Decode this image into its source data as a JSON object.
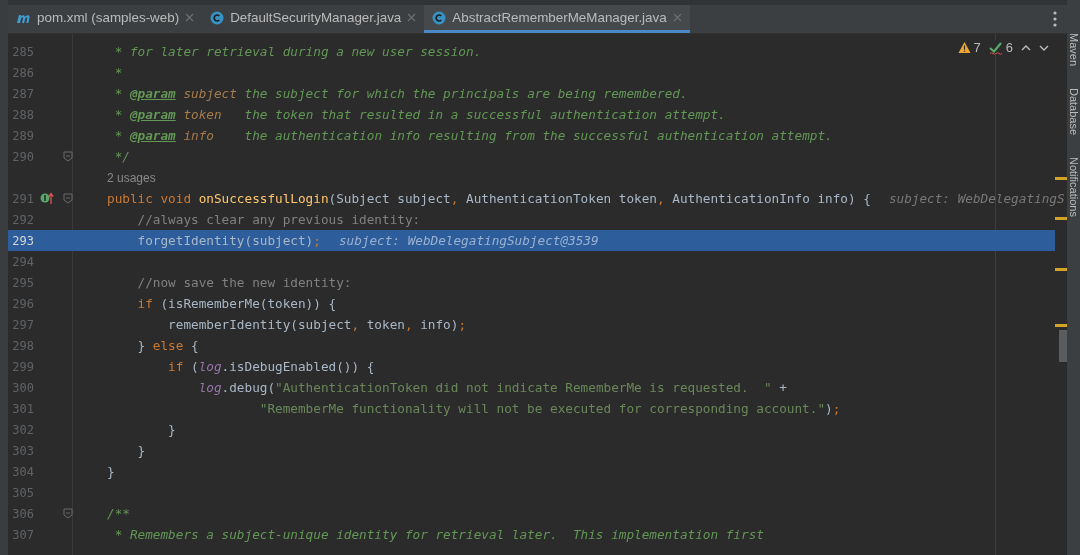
{
  "tabs": [
    {
      "label": "pom.xml (samples-web)",
      "selected": false
    },
    {
      "label": "DefaultSecurityManager.java",
      "selected": false
    },
    {
      "label": "AbstractRememberMeManager.java",
      "selected": true
    }
  ],
  "inspections": {
    "warnings": "7",
    "weak_warnings": "6"
  },
  "lines": [
    {
      "kind": "code",
      "number": "285",
      "current": false,
      "fold": false,
      "gutter_marker": false,
      "segments": [
        {
          "kind": "doc",
          "text": " * for later retrieval during a new user session."
        }
      ]
    },
    {
      "kind": "code",
      "number": "286",
      "current": false,
      "fold": false,
      "gutter_marker": false,
      "segments": [
        {
          "kind": "doc",
          "text": " *"
        }
      ]
    },
    {
      "kind": "code",
      "number": "287",
      "current": false,
      "fold": false,
      "gutter_marker": false,
      "segments": [
        {
          "kind": "doc",
          "text": " * "
        },
        {
          "kind": "doctag",
          "text": "@param"
        },
        {
          "kind": "docparam",
          "text": " subject"
        },
        {
          "kind": "doc",
          "text": " the subject for which the principals are being remembered."
        }
      ]
    },
    {
      "kind": "code",
      "number": "288",
      "current": false,
      "fold": false,
      "gutter_marker": false,
      "segments": [
        {
          "kind": "doc",
          "text": " * "
        },
        {
          "kind": "doctag",
          "text": "@param"
        },
        {
          "kind": "docparam",
          "text": " token"
        },
        {
          "kind": "doc",
          "text": "   the token that resulted in a successful authentication attempt."
        }
      ]
    },
    {
      "kind": "code",
      "number": "289",
      "current": false,
      "fold": false,
      "gutter_marker": false,
      "segments": [
        {
          "kind": "doc",
          "text": " * "
        },
        {
          "kind": "doctag",
          "text": "@param"
        },
        {
          "kind": "docparam",
          "text": " info"
        },
        {
          "kind": "doc",
          "text": "    the authentication info resulting from the successful authentication attempt."
        }
      ]
    },
    {
      "kind": "code",
      "number": "290",
      "current": false,
      "fold": true,
      "gutter_marker": false,
      "segments": [
        {
          "kind": "doc",
          "text": " */"
        }
      ]
    },
    {
      "kind": "inlay",
      "text": "2 usages"
    },
    {
      "kind": "code",
      "number": "291",
      "current": false,
      "fold": true,
      "gutter_marker": true,
      "segments": [
        {
          "kind": "keyword",
          "text": "public void "
        },
        {
          "kind": "function",
          "text": "onSuccessfulLogin"
        },
        {
          "kind": "plain",
          "text": "(Subject subject"
        },
        {
          "kind": "keyword",
          "text": ", "
        },
        {
          "kind": "plain",
          "text": "AuthenticationToken token"
        },
        {
          "kind": "keyword",
          "text": ", "
        },
        {
          "kind": "plain",
          "text": "AuthenticationInfo info) {"
        },
        {
          "kind": "hint",
          "text": "subject: WebDelegatingS"
        }
      ]
    },
    {
      "kind": "code",
      "number": "292",
      "current": false,
      "fold": false,
      "gutter_marker": false,
      "segments": [
        {
          "kind": "comment",
          "text": "    //always clear any previous identity:"
        }
      ]
    },
    {
      "kind": "code",
      "number": "293",
      "current": true,
      "fold": false,
      "gutter_marker": false,
      "segments": [
        {
          "kind": "plain",
          "text": "    forgetIdentity(subject)"
        },
        {
          "kind": "keyword",
          "text": ";"
        },
        {
          "kind": "hint",
          "text": "subject: WebDelegatingSubject@3539"
        }
      ]
    },
    {
      "kind": "code",
      "number": "294",
      "current": false,
      "fold": false,
      "gutter_marker": false
    },
    {
      "kind": "code",
      "number": "295",
      "current": false,
      "fold": false,
      "gutter_marker": false,
      "segments": [
        {
          "kind": "comment",
          "text": "    //now save the new identity:"
        }
      ]
    },
    {
      "kind": "code",
      "number": "296",
      "current": false,
      "fold": false,
      "gutter_marker": false,
      "segments": [
        {
          "kind": "keyword",
          "text": "    if"
        },
        {
          "kind": "plain",
          "text": " (isRememberMe(token)) {"
        }
      ]
    },
    {
      "kind": "code",
      "number": "297",
      "current": false,
      "fold": false,
      "gutter_marker": false,
      "segments": [
        {
          "kind": "plain",
          "text": "        rememberIdentity(subject"
        },
        {
          "kind": "keyword",
          "text": ", "
        },
        {
          "kind": "plain",
          "text": "token"
        },
        {
          "kind": "keyword",
          "text": ", "
        },
        {
          "kind": "plain",
          "text": "info)"
        },
        {
          "kind": "keyword",
          "text": ";"
        }
      ]
    },
    {
      "kind": "code",
      "number": "298",
      "current": false,
      "fold": false,
      "gutter_marker": false,
      "segments": [
        {
          "kind": "plain",
          "text": "    } "
        },
        {
          "kind": "keyword",
          "text": "else"
        },
        {
          "kind": "plain",
          "text": " {"
        }
      ]
    },
    {
      "kind": "code",
      "number": "299",
      "current": false,
      "fold": false,
      "gutter_marker": false,
      "segments": [
        {
          "kind": "keyword",
          "text": "        if"
        },
        {
          "kind": "plain",
          "text": " ("
        },
        {
          "kind": "field",
          "text": "log"
        },
        {
          "kind": "plain",
          "text": ".isDebugEnabled()) {"
        }
      ]
    },
    {
      "kind": "code",
      "number": "300",
      "current": false,
      "fold": false,
      "gutter_marker": false,
      "segments": [
        {
          "kind": "field",
          "text": "            log"
        },
        {
          "kind": "plain",
          "text": ".debug("
        },
        {
          "kind": "string",
          "text": "\"AuthenticationToken did not indicate RememberMe is requested.  \""
        },
        {
          "kind": "plain",
          "text": " +"
        }
      ]
    },
    {
      "kind": "code",
      "number": "301",
      "current": false,
      "fold": false,
      "gutter_marker": false,
      "segments": [
        {
          "kind": "string",
          "text": "                    \"RememberMe functionality will not be executed for corresponding account.\""
        },
        {
          "kind": "plain",
          "text": ")"
        },
        {
          "kind": "keyword",
          "text": ";"
        }
      ]
    },
    {
      "kind": "code",
      "number": "302",
      "current": false,
      "fold": false,
      "gutter_marker": false,
      "segments": [
        {
          "kind": "plain",
          "text": "        }"
        }
      ]
    },
    {
      "kind": "code",
      "number": "303",
      "current": false,
      "fold": false,
      "gutter_marker": false,
      "segments": [
        {
          "kind": "plain",
          "text": "    }"
        }
      ]
    },
    {
      "kind": "code",
      "number": "304",
      "current": false,
      "fold": false,
      "gutter_marker": false,
      "segments": [
        {
          "kind": "plain",
          "text": "}"
        }
      ]
    },
    {
      "kind": "code",
      "number": "305",
      "current": false,
      "fold": false,
      "gutter_marker": false
    },
    {
      "kind": "code",
      "number": "306",
      "current": false,
      "fold": true,
      "gutter_marker": false,
      "segments": [
        {
          "kind": "doc",
          "text": "/**"
        }
      ]
    },
    {
      "kind": "code",
      "number": "307",
      "current": false,
      "fold": false,
      "gutter_marker": false,
      "segments": [
        {
          "kind": "doc",
          "text": " * Remembers a subject-unique identity for retrieval later.  This implementation first"
        }
      ]
    }
  ],
  "tool_strip": [
    "Maven",
    "Database",
    "Notifications"
  ]
}
